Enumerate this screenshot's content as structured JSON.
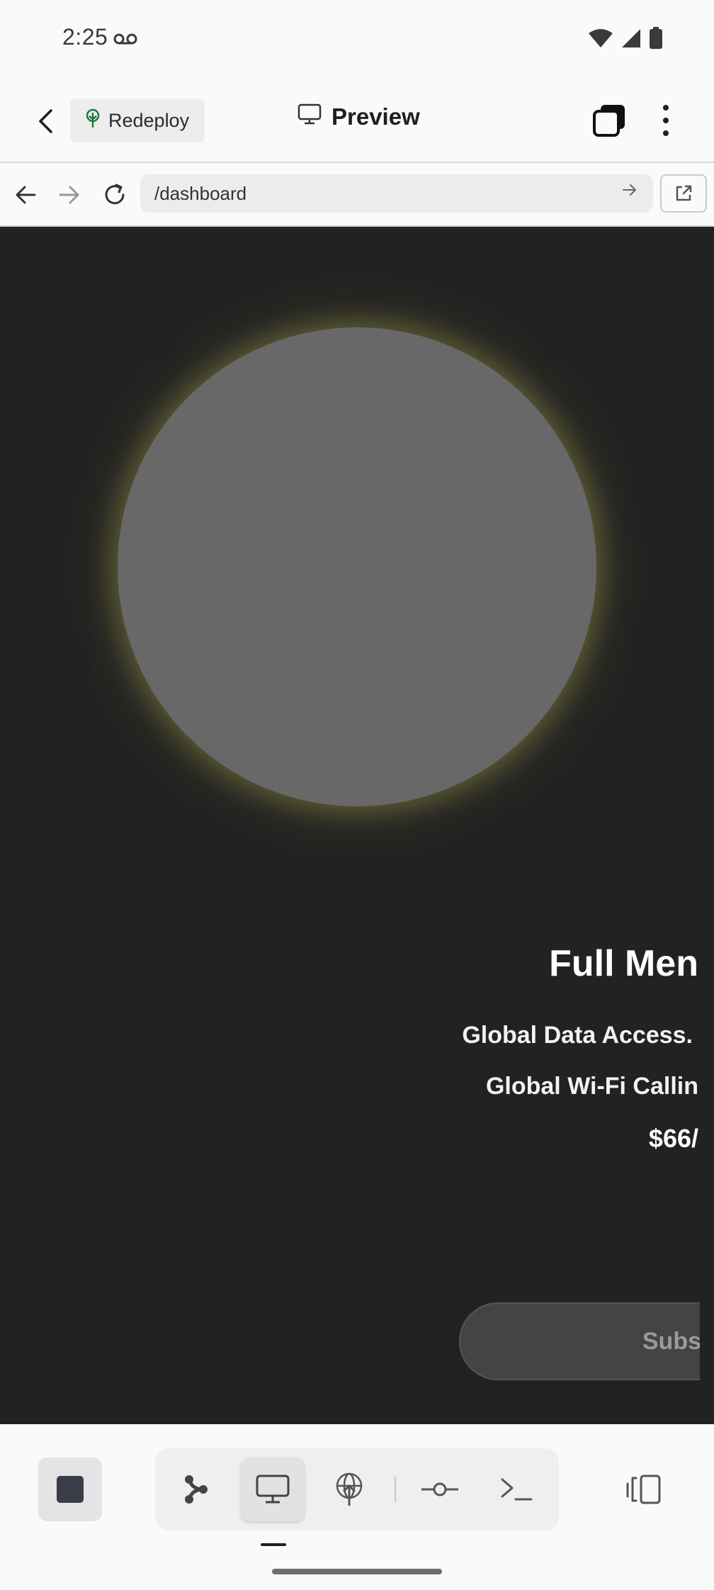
{
  "status_bar": {
    "time": "2:25"
  },
  "header": {
    "redeploy_label": "Redeploy",
    "title": "Preview"
  },
  "browser": {
    "url": "/dashboard"
  },
  "preview": {
    "plan_title": "Full Men",
    "features": [
      "Global Data Access.",
      "Global Wi-Fi Callin"
    ],
    "price": "$66/",
    "subscribe_label": "Subs"
  },
  "colors": {
    "content_bg": "#222222",
    "circle": "#686868",
    "circle_glow": "#d2cd5f",
    "accent_green": "#1e7a3a"
  }
}
